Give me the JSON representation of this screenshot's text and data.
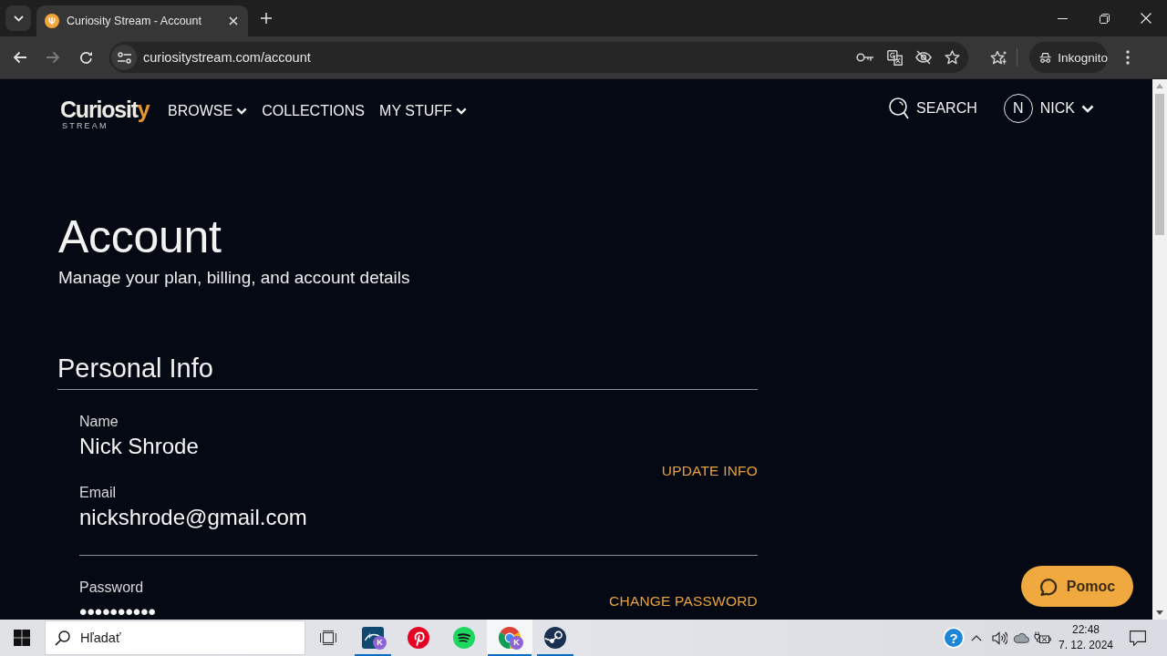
{
  "browser": {
    "tabs": [
      {
        "title": "Curiosity Stream - Account",
        "selected": true
      }
    ],
    "nav_buttons": [
      {
        "kind": "back",
        "disabled": false
      },
      {
        "kind": "forward",
        "disabled": true
      },
      {
        "kind": "reload",
        "disabled": false
      }
    ],
    "address": "curiositystream.com/account",
    "profile_chip": "Inkognito"
  },
  "site_nav": {
    "logo": {
      "wordmark": "Curiosity",
      "tagline": "STREAM"
    },
    "items": [
      {
        "label": "BROWSE",
        "kind": "dropdown"
      },
      {
        "label": "COLLECTIONS",
        "kind": "link"
      },
      {
        "label": "MY STUFF",
        "kind": "dropdown"
      }
    ],
    "search": "SEARCH",
    "user": {
      "initial": "N",
      "name": "NICK"
    }
  },
  "account": {
    "title": "Account",
    "subtitle": "Manage your plan, billing, and account details",
    "sections": [
      {
        "title": "Personal Info",
        "groups": [
          {
            "fields": [
              {
                "label": "Name",
                "value": "Nick Shrode"
              },
              {
                "label": "Email",
                "value": "nickshrode@gmail.com"
              }
            ],
            "action": "UPDATE INFO"
          },
          {
            "fields": [
              {
                "label": "Password",
                "value": "••••••••••"
              }
            ],
            "action": "CHANGE PASSWORD"
          }
        ]
      }
    ]
  },
  "help_button": {
    "label": "Pomoc"
  },
  "taskbar": {
    "search_placeholder": "Hľadať",
    "apps": [
      {
        "kind": "tile",
        "badge": "K",
        "running": true,
        "selected": false
      },
      {
        "kind": "pin",
        "running": false,
        "selected": false
      },
      {
        "kind": "waves",
        "running": false,
        "selected": false
      },
      {
        "kind": "ring",
        "badge": "K",
        "running": true,
        "selected": true
      },
      {
        "kind": "piston",
        "running": true,
        "selected": false
      }
    ],
    "tray": {
      "help": "?",
      "time": "22:48",
      "date": "7. 12. 2024"
    }
  }
}
